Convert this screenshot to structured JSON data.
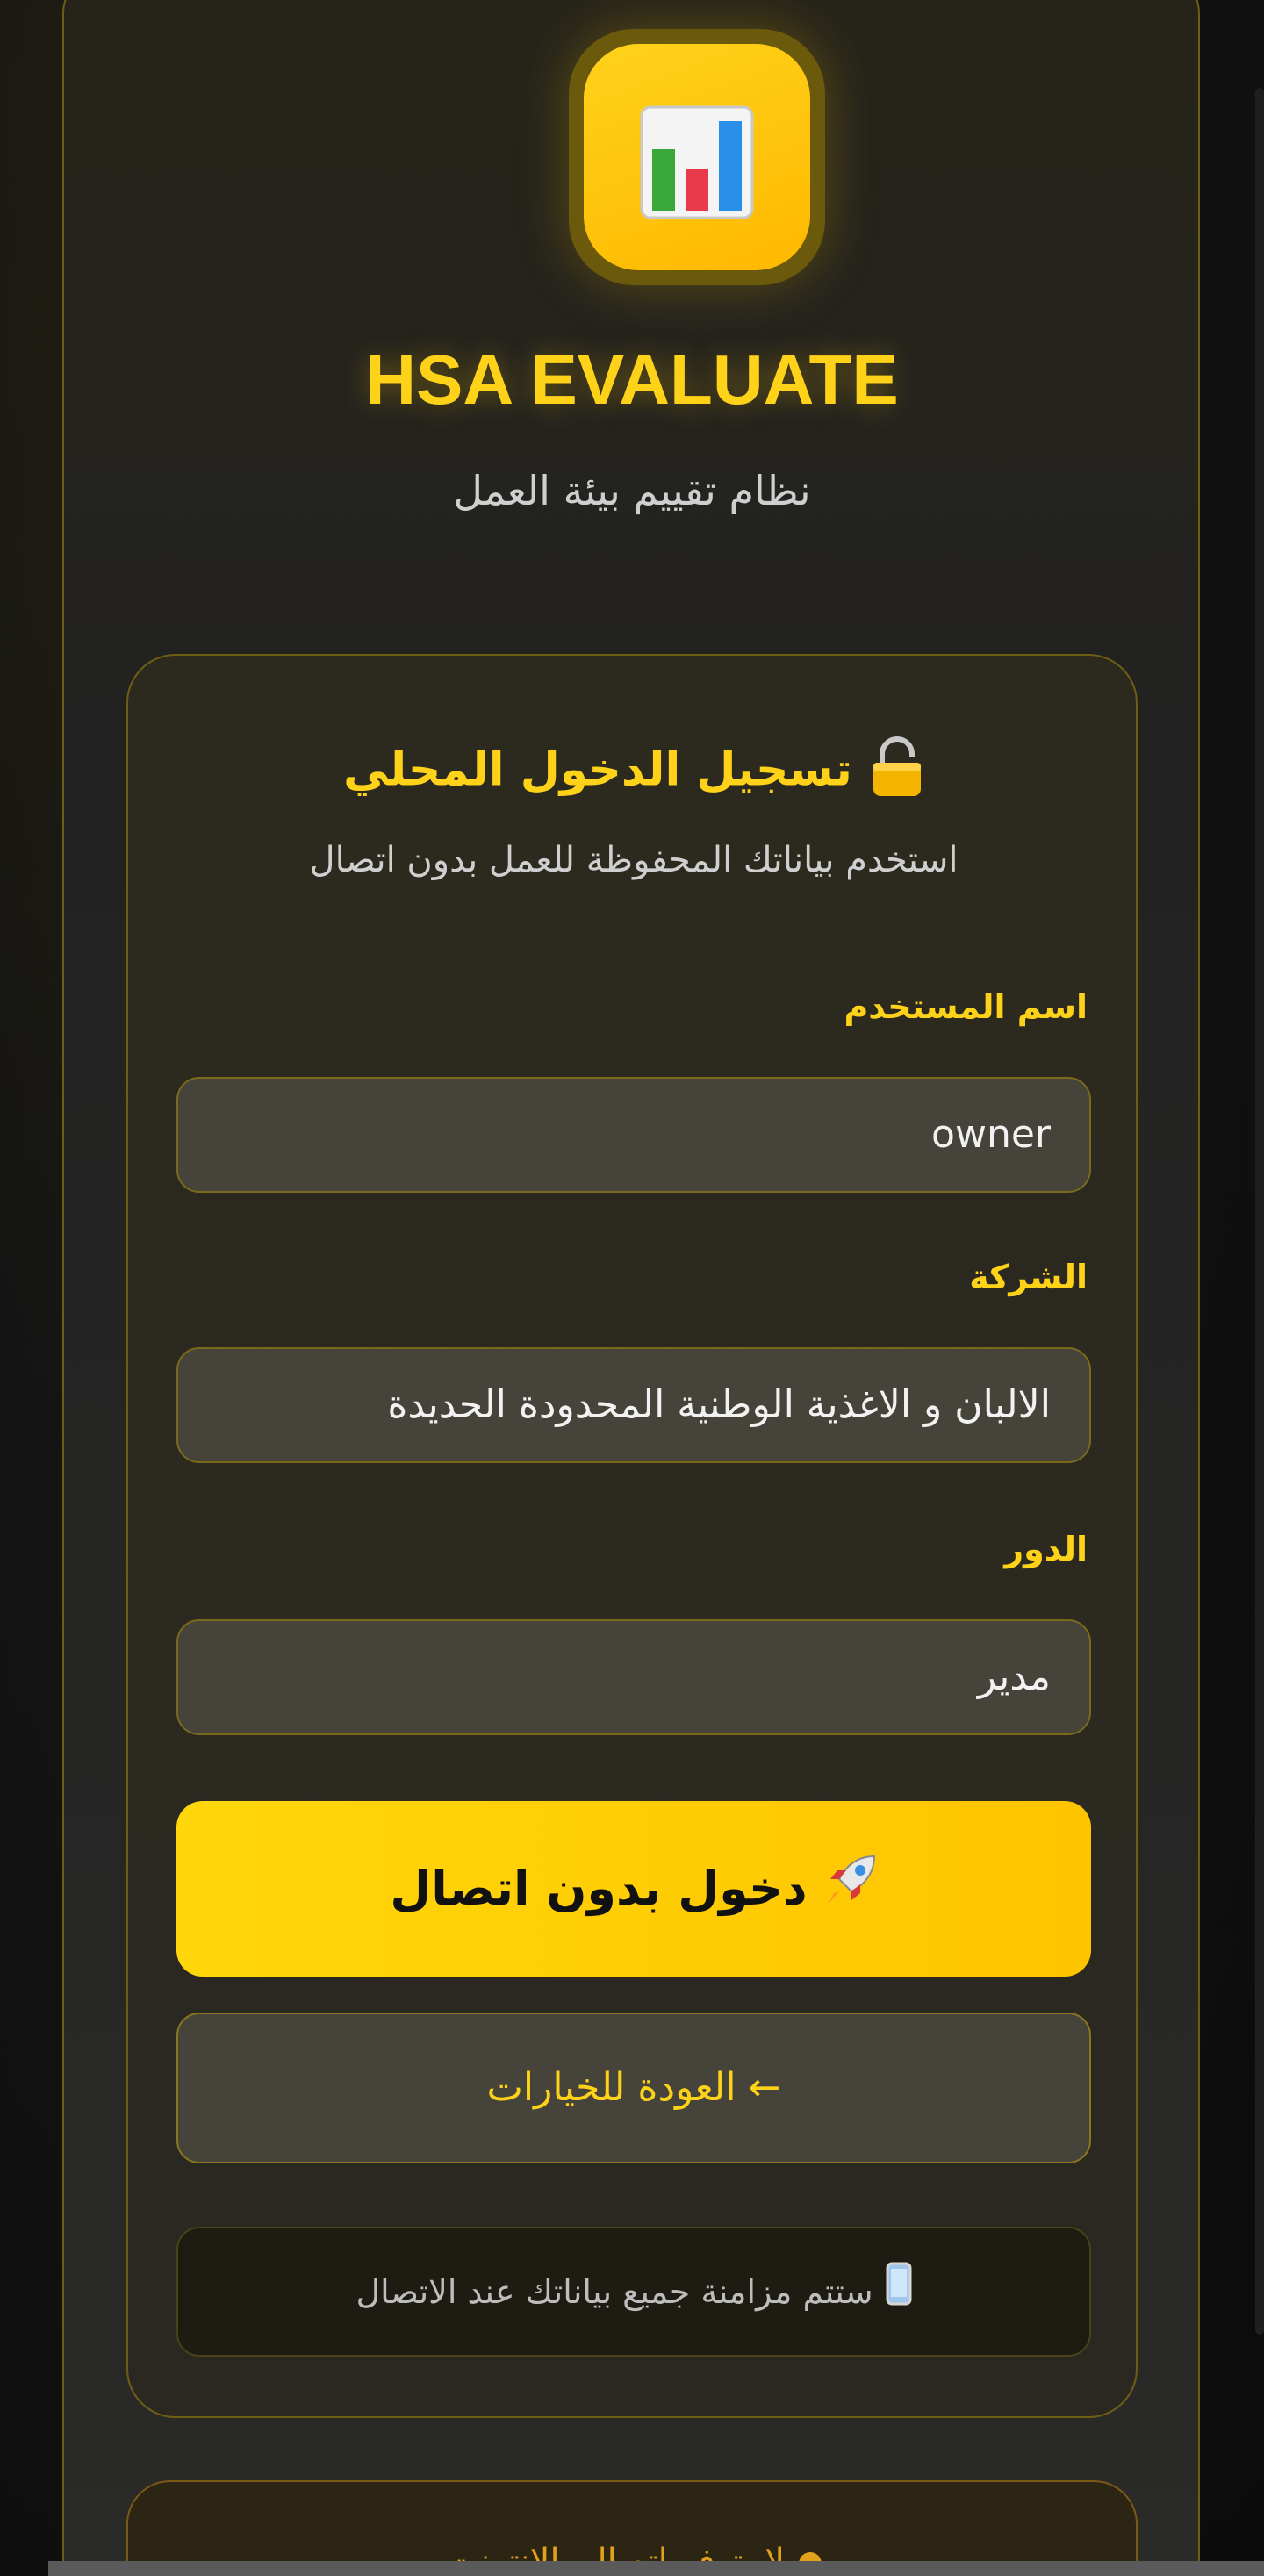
{
  "app": {
    "title": "HSA EVALUATE",
    "subtitle": "نظام تقييم بيئة العمل",
    "logo_icon": "bar-chart-icon"
  },
  "login": {
    "title": "تسجيل الدخول المحلي",
    "title_icon": "lock-icon",
    "subtitle": "استخدم بياناتك المحفوظة للعمل بدون اتصال",
    "username_label": "اسم المستخدم",
    "username_value": "owner",
    "company_label": "الشركة",
    "company_value": "الالبان و الاغذية الوطنية المحدودة الحديدة",
    "role_label": "الدور",
    "role_value": "مدير",
    "submit_label": "دخول بدون اتصال",
    "submit_icon": "rocket-icon",
    "back_label": "← العودة للخيارات",
    "sync_note": "ستتم مزامنة جميع بياناتك عند الاتصال",
    "sync_icon": "phone-icon"
  },
  "status": {
    "text": "لا يتوفر اتصال بالإنترنت",
    "dot_color": "#e0a21a"
  },
  "colors": {
    "accent": "#ffd21a",
    "background": "#141414"
  }
}
